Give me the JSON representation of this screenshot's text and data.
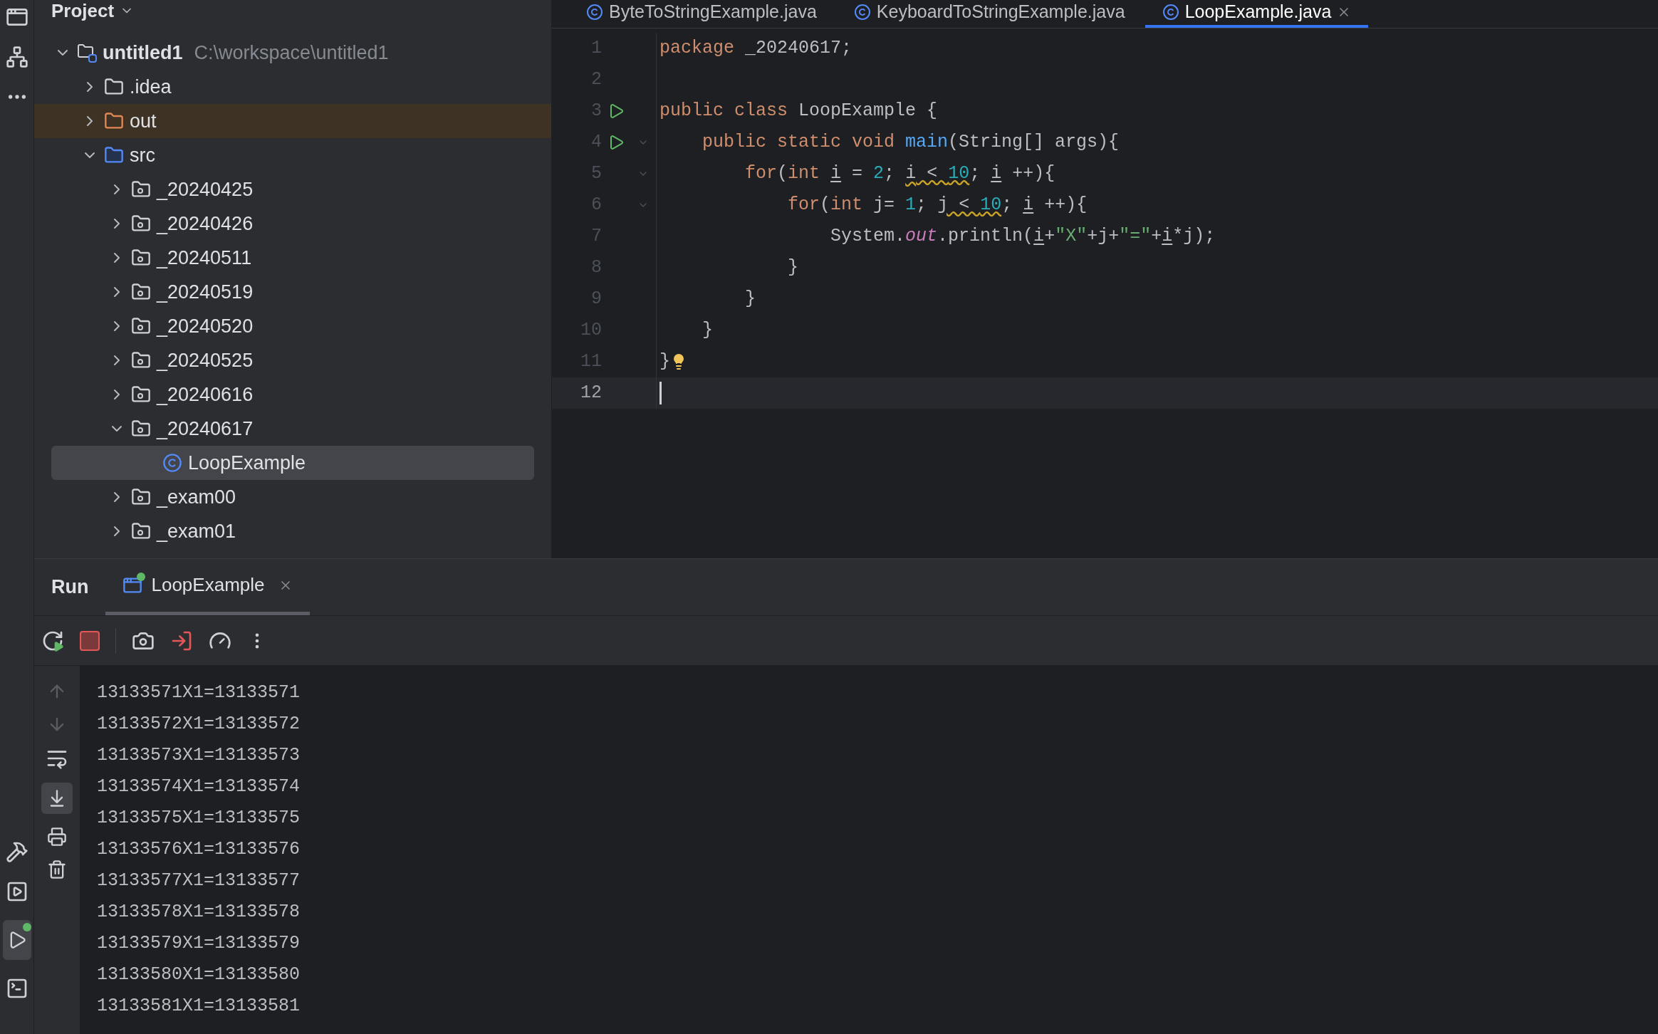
{
  "project_panel": {
    "title": "Project",
    "tree": [
      {
        "label": "untitled1",
        "path": "C:\\workspace\\untitled1",
        "kind": "project",
        "expanded": true,
        "selected": false,
        "children": [
          {
            "label": ".idea",
            "kind": "folder",
            "expanded": false,
            "selected": false
          },
          {
            "label": "out",
            "kind": "excluded",
            "expanded": false,
            "selected": false
          },
          {
            "label": "src",
            "kind": "source",
            "expanded": true,
            "selected": false,
            "children": [
              {
                "label": "_20240425",
                "kind": "package",
                "expanded": false,
                "selected": false
              },
              {
                "label": "_20240426",
                "kind": "package",
                "expanded": false,
                "selected": false
              },
              {
                "label": "_20240511",
                "kind": "package",
                "expanded": false,
                "selected": false
              },
              {
                "label": "_20240519",
                "kind": "package",
                "expanded": false,
                "selected": false
              },
              {
                "label": "_20240520",
                "kind": "package",
                "expanded": false,
                "selected": false
              },
              {
                "label": "_20240525",
                "kind": "package",
                "expanded": false,
                "selected": false
              },
              {
                "label": "_20240616",
                "kind": "package",
                "expanded": false,
                "selected": false
              },
              {
                "label": "_20240617",
                "kind": "package",
                "expanded": true,
                "selected": false,
                "children": [
                  {
                    "label": "LoopExample",
                    "kind": "class",
                    "selected": true
                  }
                ]
              },
              {
                "label": "_exam00",
                "kind": "package",
                "expanded": false,
                "selected": false
              },
              {
                "label": "_exam01",
                "kind": "package",
                "expanded": false,
                "selected": false
              }
            ]
          }
        ]
      }
    ]
  },
  "editor_tabs": [
    {
      "label": "ByteToStringExample.java",
      "selected": false
    },
    {
      "label": "KeyboardToStringExample.java",
      "selected": false
    },
    {
      "label": "LoopExample.java",
      "selected": true
    }
  ],
  "code_lines": [
    {
      "number": "1",
      "tokens": [
        {
          "text": "package",
          "kind": "keyword"
        },
        {
          "text": " _20240617;",
          "kind": "plain"
        }
      ]
    },
    {
      "number": "2"
    },
    {
      "number": "3",
      "run": true,
      "tokens": [
        {
          "text": "public class",
          "kind": "keyword"
        },
        {
          "text": " LoopExample {",
          "kind": "plain"
        }
      ]
    },
    {
      "number": "4",
      "run": true,
      "fold": true,
      "tokens": [
        {
          "text": "    public static void",
          "kind": "keyword"
        },
        {
          "text": " main",
          "kind": "method"
        },
        {
          "text": "(String[] args){",
          "kind": "plain"
        }
      ]
    },
    {
      "number": "5",
      "fold": true,
      "tokens": [
        {
          "text": "        for",
          "kind": "keyword"
        },
        {
          "text": "(",
          "kind": "plain"
        },
        {
          "text": "int ",
          "kind": "keyword"
        },
        {
          "text": "i",
          "kind": "var"
        },
        {
          "text": " = ",
          "kind": "plain"
        },
        {
          "text": "2",
          "kind": "number"
        },
        {
          "text": "; ",
          "kind": "plain"
        },
        {
          "text": "i",
          "kind": "var",
          "warn": true
        },
        {
          "text": " < ",
          "kind": "plain",
          "warn": true
        },
        {
          "text": "10",
          "kind": "number",
          "warn": true
        },
        {
          "text": "; ",
          "kind": "plain"
        },
        {
          "text": "i",
          "kind": "var"
        },
        {
          "text": " ++){",
          "kind": "plain"
        }
      ]
    },
    {
      "number": "6",
      "fold": true,
      "tokens": [
        {
          "text": "            for",
          "kind": "keyword"
        },
        {
          "text": "(",
          "kind": "plain"
        },
        {
          "text": "int",
          "kind": "keyword"
        },
        {
          "text": " j= ",
          "kind": "plain"
        },
        {
          "text": "1",
          "kind": "number"
        },
        {
          "text": "; ",
          "kind": "plain"
        },
        {
          "text": "j < ",
          "kind": "plain",
          "warn": true
        },
        {
          "text": "10",
          "kind": "number",
          "warn": true
        },
        {
          "text": "; ",
          "kind": "plain"
        },
        {
          "text": "i",
          "kind": "var"
        },
        {
          "text": " ++){",
          "kind": "plain"
        }
      ]
    },
    {
      "number": "7",
      "tokens": [
        {
          "text": "                System.",
          "kind": "plain"
        },
        {
          "text": "out",
          "kind": "field"
        },
        {
          "text": ".println(",
          "kind": "plain"
        },
        {
          "text": "i",
          "kind": "var"
        },
        {
          "text": "+",
          "kind": "plain"
        },
        {
          "text": "\"X\"",
          "kind": "string"
        },
        {
          "text": "+j+",
          "kind": "plain"
        },
        {
          "text": "\"=\"",
          "kind": "string"
        },
        {
          "text": "+",
          "kind": "plain"
        },
        {
          "text": "i",
          "kind": "var"
        },
        {
          "text": "*j);",
          "kind": "plain"
        }
      ]
    },
    {
      "number": "8",
      "tokens": [
        {
          "text": "            }",
          "kind": "plain"
        }
      ]
    },
    {
      "number": "9",
      "tokens": [
        {
          "text": "        }",
          "kind": "plain"
        }
      ]
    },
    {
      "number": "10",
      "tokens": [
        {
          "text": "    }",
          "kind": "plain"
        }
      ]
    },
    {
      "number": "11",
      "bulb": true,
      "tokens": [
        {
          "text": "}",
          "kind": "plain"
        }
      ]
    },
    {
      "number": "12",
      "current": true
    }
  ],
  "run_panel": {
    "title": "Run",
    "tabs": [
      {
        "label": "LoopExample",
        "selected": true
      }
    ],
    "output": [
      "13133571X1=13133571",
      "13133572X1=13133572",
      "13133573X1=13133573",
      "13133574X1=13133574",
      "13133575X1=13133575",
      "13133576X1=13133576",
      "13133577X1=13133577",
      "13133578X1=13133578",
      "13133579X1=13133579",
      "13133580X1=13133580",
      "13133581X1=13133581"
    ]
  }
}
